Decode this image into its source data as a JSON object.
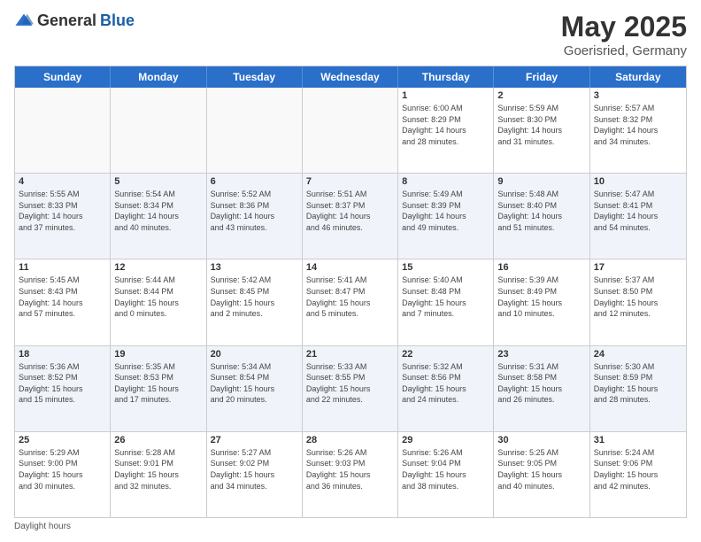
{
  "header": {
    "logo_general": "General",
    "logo_blue": "Blue",
    "title": "May 2025",
    "subtitle": "Goerisried, Germany"
  },
  "weekdays": [
    "Sunday",
    "Monday",
    "Tuesday",
    "Wednesday",
    "Thursday",
    "Friday",
    "Saturday"
  ],
  "weeks": [
    [
      {
        "day": "",
        "info": ""
      },
      {
        "day": "",
        "info": ""
      },
      {
        "day": "",
        "info": ""
      },
      {
        "day": "",
        "info": ""
      },
      {
        "day": "1",
        "info": "Sunrise: 6:00 AM\nSunset: 8:29 PM\nDaylight: 14 hours\nand 28 minutes."
      },
      {
        "day": "2",
        "info": "Sunrise: 5:59 AM\nSunset: 8:30 PM\nDaylight: 14 hours\nand 31 minutes."
      },
      {
        "day": "3",
        "info": "Sunrise: 5:57 AM\nSunset: 8:32 PM\nDaylight: 14 hours\nand 34 minutes."
      }
    ],
    [
      {
        "day": "4",
        "info": "Sunrise: 5:55 AM\nSunset: 8:33 PM\nDaylight: 14 hours\nand 37 minutes."
      },
      {
        "day": "5",
        "info": "Sunrise: 5:54 AM\nSunset: 8:34 PM\nDaylight: 14 hours\nand 40 minutes."
      },
      {
        "day": "6",
        "info": "Sunrise: 5:52 AM\nSunset: 8:36 PM\nDaylight: 14 hours\nand 43 minutes."
      },
      {
        "day": "7",
        "info": "Sunrise: 5:51 AM\nSunset: 8:37 PM\nDaylight: 14 hours\nand 46 minutes."
      },
      {
        "day": "8",
        "info": "Sunrise: 5:49 AM\nSunset: 8:39 PM\nDaylight: 14 hours\nand 49 minutes."
      },
      {
        "day": "9",
        "info": "Sunrise: 5:48 AM\nSunset: 8:40 PM\nDaylight: 14 hours\nand 51 minutes."
      },
      {
        "day": "10",
        "info": "Sunrise: 5:47 AM\nSunset: 8:41 PM\nDaylight: 14 hours\nand 54 minutes."
      }
    ],
    [
      {
        "day": "11",
        "info": "Sunrise: 5:45 AM\nSunset: 8:43 PM\nDaylight: 14 hours\nand 57 minutes."
      },
      {
        "day": "12",
        "info": "Sunrise: 5:44 AM\nSunset: 8:44 PM\nDaylight: 15 hours\nand 0 minutes."
      },
      {
        "day": "13",
        "info": "Sunrise: 5:42 AM\nSunset: 8:45 PM\nDaylight: 15 hours\nand 2 minutes."
      },
      {
        "day": "14",
        "info": "Sunrise: 5:41 AM\nSunset: 8:47 PM\nDaylight: 15 hours\nand 5 minutes."
      },
      {
        "day": "15",
        "info": "Sunrise: 5:40 AM\nSunset: 8:48 PM\nDaylight: 15 hours\nand 7 minutes."
      },
      {
        "day": "16",
        "info": "Sunrise: 5:39 AM\nSunset: 8:49 PM\nDaylight: 15 hours\nand 10 minutes."
      },
      {
        "day": "17",
        "info": "Sunrise: 5:37 AM\nSunset: 8:50 PM\nDaylight: 15 hours\nand 12 minutes."
      }
    ],
    [
      {
        "day": "18",
        "info": "Sunrise: 5:36 AM\nSunset: 8:52 PM\nDaylight: 15 hours\nand 15 minutes."
      },
      {
        "day": "19",
        "info": "Sunrise: 5:35 AM\nSunset: 8:53 PM\nDaylight: 15 hours\nand 17 minutes."
      },
      {
        "day": "20",
        "info": "Sunrise: 5:34 AM\nSunset: 8:54 PM\nDaylight: 15 hours\nand 20 minutes."
      },
      {
        "day": "21",
        "info": "Sunrise: 5:33 AM\nSunset: 8:55 PM\nDaylight: 15 hours\nand 22 minutes."
      },
      {
        "day": "22",
        "info": "Sunrise: 5:32 AM\nSunset: 8:56 PM\nDaylight: 15 hours\nand 24 minutes."
      },
      {
        "day": "23",
        "info": "Sunrise: 5:31 AM\nSunset: 8:58 PM\nDaylight: 15 hours\nand 26 minutes."
      },
      {
        "day": "24",
        "info": "Sunrise: 5:30 AM\nSunset: 8:59 PM\nDaylight: 15 hours\nand 28 minutes."
      }
    ],
    [
      {
        "day": "25",
        "info": "Sunrise: 5:29 AM\nSunset: 9:00 PM\nDaylight: 15 hours\nand 30 minutes."
      },
      {
        "day": "26",
        "info": "Sunrise: 5:28 AM\nSunset: 9:01 PM\nDaylight: 15 hours\nand 32 minutes."
      },
      {
        "day": "27",
        "info": "Sunrise: 5:27 AM\nSunset: 9:02 PM\nDaylight: 15 hours\nand 34 minutes."
      },
      {
        "day": "28",
        "info": "Sunrise: 5:26 AM\nSunset: 9:03 PM\nDaylight: 15 hours\nand 36 minutes."
      },
      {
        "day": "29",
        "info": "Sunrise: 5:26 AM\nSunset: 9:04 PM\nDaylight: 15 hours\nand 38 minutes."
      },
      {
        "day": "30",
        "info": "Sunrise: 5:25 AM\nSunset: 9:05 PM\nDaylight: 15 hours\nand 40 minutes."
      },
      {
        "day": "31",
        "info": "Sunrise: 5:24 AM\nSunset: 9:06 PM\nDaylight: 15 hours\nand 42 minutes."
      }
    ]
  ],
  "footer": "Daylight hours"
}
